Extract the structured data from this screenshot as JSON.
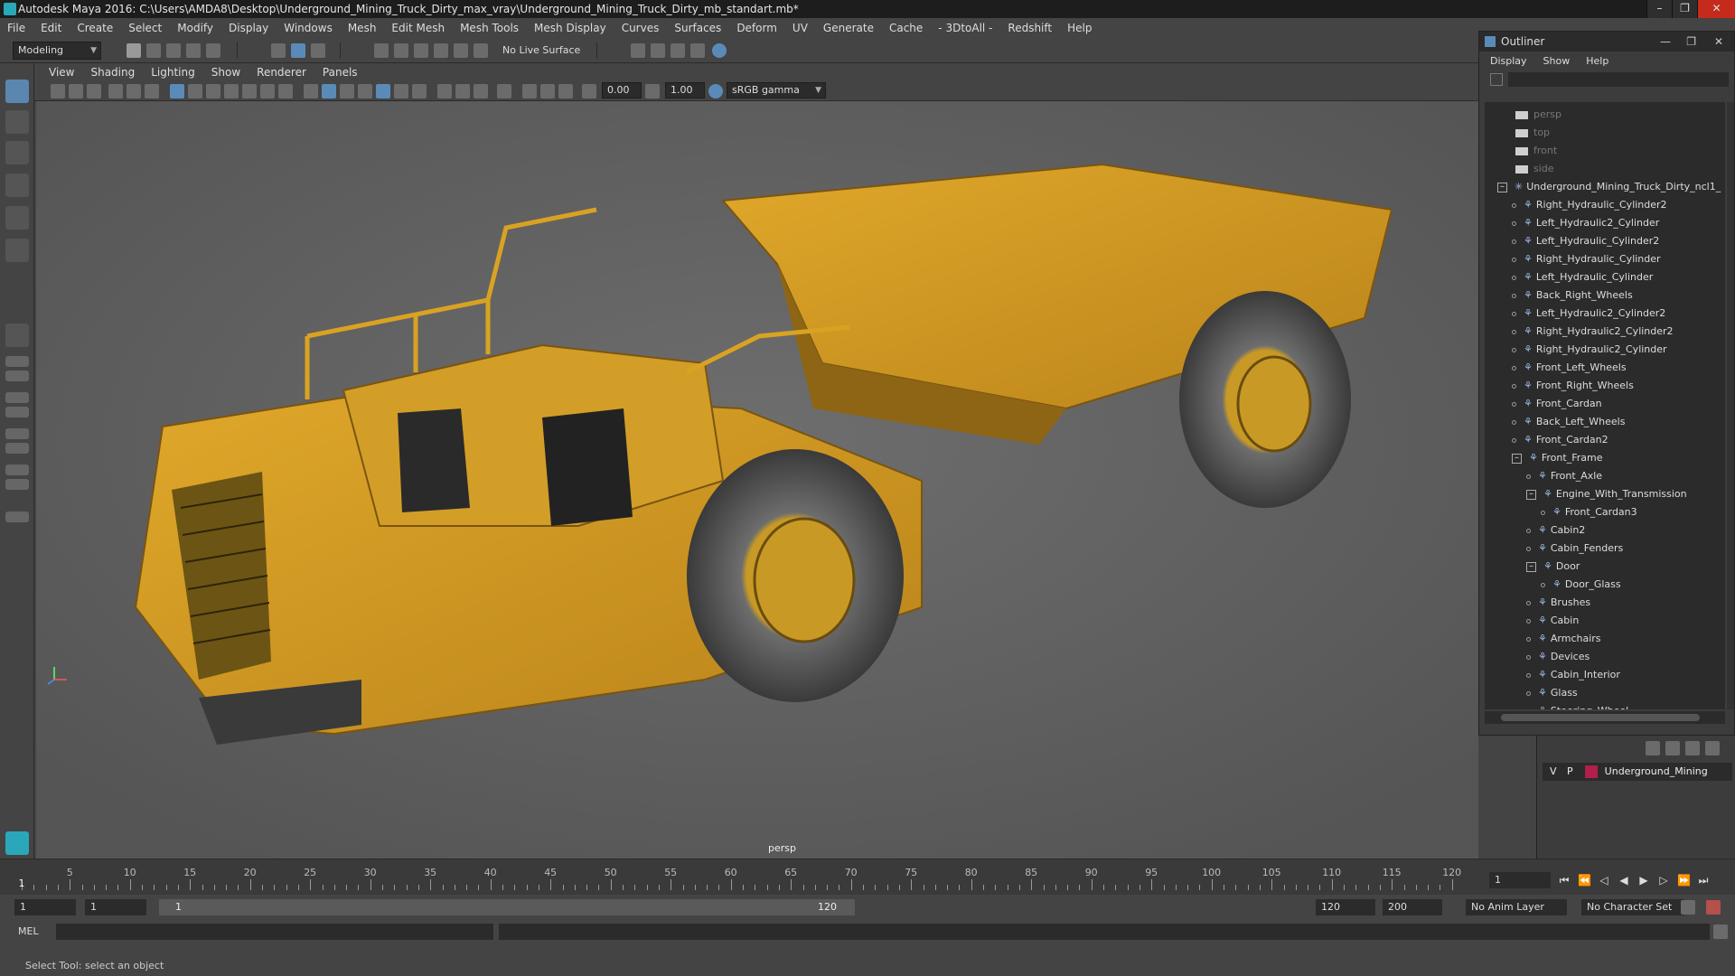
{
  "window": {
    "title": "Autodesk Maya 2016: C:\\Users\\AMDA8\\Desktop\\Underground_Mining_Truck_Dirty_max_vray\\Underground_Mining_Truck_Dirty_mb_standart.mb*"
  },
  "menubar": [
    "File",
    "Edit",
    "Create",
    "Select",
    "Modify",
    "Display",
    "Windows",
    "Mesh",
    "Edit Mesh",
    "Mesh Tools",
    "Mesh Display",
    "Curves",
    "Surfaces",
    "Deform",
    "UV",
    "Generate",
    "Cache",
    "- 3DtoAll -",
    "Redshift",
    "Help"
  ],
  "shelf": {
    "mode": "Modeling",
    "live_surface": "No Live Surface"
  },
  "viewport": {
    "menu": [
      "View",
      "Shading",
      "Lighting",
      "Show",
      "Renderer",
      "Panels"
    ],
    "exposure": "0.00",
    "gamma": "1.00",
    "color_space": "sRGB gamma",
    "camera_label": "persp"
  },
  "outliner": {
    "title": "Outliner",
    "menu": [
      "Display",
      "Show",
      "Help"
    ],
    "items": [
      {
        "label": "persp",
        "indent": 0,
        "kind": "camera"
      },
      {
        "label": "top",
        "indent": 0,
        "kind": "camera"
      },
      {
        "label": "front",
        "indent": 0,
        "kind": "camera"
      },
      {
        "label": "side",
        "indent": 0,
        "kind": "camera"
      },
      {
        "label": "Underground_Mining_Truck_Dirty_ncl1_",
        "indent": 0,
        "kind": "root"
      },
      {
        "label": "Right_Hydraulic_Cylinder2",
        "indent": 1,
        "kind": "mesh"
      },
      {
        "label": "Left_Hydraulic2_Cylinder",
        "indent": 1,
        "kind": "mesh"
      },
      {
        "label": "Left_Hydraulic_Cylinder2",
        "indent": 1,
        "kind": "mesh"
      },
      {
        "label": "Right_Hydraulic_Cylinder",
        "indent": 1,
        "kind": "mesh"
      },
      {
        "label": "Left_Hydraulic_Cylinder",
        "indent": 1,
        "kind": "mesh"
      },
      {
        "label": "Back_Right_Wheels",
        "indent": 1,
        "kind": "mesh"
      },
      {
        "label": "Left_Hydraulic2_Cylinder2",
        "indent": 1,
        "kind": "mesh"
      },
      {
        "label": "Right_Hydraulic2_Cylinder2",
        "indent": 1,
        "kind": "mesh"
      },
      {
        "label": "Right_Hydraulic2_Cylinder",
        "indent": 1,
        "kind": "mesh"
      },
      {
        "label": "Front_Left_Wheels",
        "indent": 1,
        "kind": "mesh"
      },
      {
        "label": "Front_Right_Wheels",
        "indent": 1,
        "kind": "mesh"
      },
      {
        "label": "Front_Cardan",
        "indent": 1,
        "kind": "mesh"
      },
      {
        "label": "Back_Left_Wheels",
        "indent": 1,
        "kind": "mesh"
      },
      {
        "label": "Front_Cardan2",
        "indent": 1,
        "kind": "mesh"
      },
      {
        "label": "Front_Frame",
        "indent": 1,
        "kind": "group"
      },
      {
        "label": "Front_Axle",
        "indent": 2,
        "kind": "mesh"
      },
      {
        "label": "Engine_With_Transmission",
        "indent": 2,
        "kind": "group"
      },
      {
        "label": "Front_Cardan3",
        "indent": 3,
        "kind": "mesh"
      },
      {
        "label": "Cabin2",
        "indent": 2,
        "kind": "mesh"
      },
      {
        "label": "Cabin_Fenders",
        "indent": 2,
        "kind": "mesh"
      },
      {
        "label": "Door",
        "indent": 2,
        "kind": "group"
      },
      {
        "label": "Door_Glass",
        "indent": 3,
        "kind": "mesh"
      },
      {
        "label": "Brushes",
        "indent": 2,
        "kind": "mesh"
      },
      {
        "label": "Cabin",
        "indent": 2,
        "kind": "mesh"
      },
      {
        "label": "Armchairs",
        "indent": 2,
        "kind": "mesh"
      },
      {
        "label": "Devices",
        "indent": 2,
        "kind": "mesh"
      },
      {
        "label": "Cabin_Interior",
        "indent": 2,
        "kind": "mesh"
      },
      {
        "label": "Glass",
        "indent": 2,
        "kind": "mesh"
      },
      {
        "label": "Steering_Wheel",
        "indent": 2,
        "kind": "mesh"
      }
    ]
  },
  "layers": {
    "v": "V",
    "p": "P",
    "name": "Underground_Mining",
    "color": "#b0204a"
  },
  "timeline": {
    "ticks": [
      "5",
      "10",
      "15",
      "20",
      "25",
      "30",
      "35",
      "40",
      "45",
      "50",
      "55",
      "60",
      "65",
      "70",
      "75",
      "80",
      "85",
      "90",
      "95",
      "100",
      "105",
      "110",
      "115",
      "120"
    ],
    "current_frame_label": "1",
    "current_frame": "1"
  },
  "range": {
    "start": "1",
    "playback_start": "1",
    "bar_start": "1",
    "bar_end": "120",
    "playback_end": "120",
    "end": "200",
    "anim_layer": "No Anim Layer",
    "character_set": "No Character Set"
  },
  "command": {
    "label": "MEL"
  },
  "status": "Select Tool: select an object"
}
